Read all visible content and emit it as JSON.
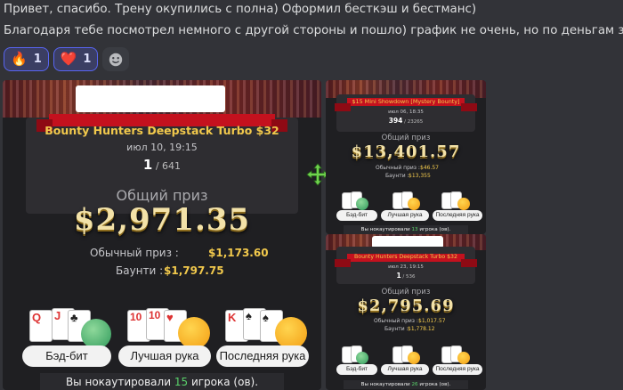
{
  "message": {
    "line1": "Привет, спасибо. Трену окупились с полна) Оформил бесткэш и бестманс)",
    "line2": "Благодаря тебе посмотрел немного с другой стороны и пошло) график не очень, но по деньгам збс)"
  },
  "reactions": [
    {
      "emoji": "🔥",
      "count": "1"
    },
    {
      "emoji": "❤️",
      "count": "1"
    }
  ],
  "card_main": {
    "title": "Bounty Hunters Deepstack Turbo $32",
    "date": "июл 10, 19:15",
    "place": "1",
    "total": "/ 641",
    "prize_label": "Общий приз",
    "prize_value": "$2,971.35",
    "regular_label": "Обычный приз :",
    "regular_value": "$1,173.60",
    "bounty_label": "Баунти :",
    "bounty_value": "$1,797.75",
    "badges": [
      "Бэд-бит",
      "Лучшая рука",
      "Последняя рука"
    ],
    "footer_pre": "Вы нокаутировали",
    "footer_num": "15",
    "footer_post": "игрока (ов)."
  },
  "card_top_right": {
    "title": "$15 Mini Showdown [Mystery Bounty]",
    "date": "июл 06, 18:35",
    "place": "394",
    "total": "/ 23265",
    "prize_label": "Общий приз",
    "prize_value": "$13,401.57",
    "regular_label": "Обычный приз :",
    "regular_value": "$46.57",
    "bounty_label": "Баунти :",
    "bounty_value": "$13,355",
    "badges": [
      "Бэд-бит",
      "Лучшая рука",
      "Последняя рука"
    ],
    "footer_pre": "Вы нокаутировали",
    "footer_num": "13",
    "footer_post": "игрока (ов)."
  },
  "card_bottom_right": {
    "title": "Bounty Hunters Deepstack Turbo $32",
    "date": "июл 23, 19:15",
    "place": "1",
    "total": "/ 536",
    "prize_label": "Общий приз",
    "prize_value": "$2,795.69",
    "regular_label": "Обычный приз :",
    "regular_value": "$1,017.57",
    "bounty_label": "Баунти :",
    "bounty_value": "$1,778.12",
    "badges": [
      "Бэд-бит",
      "Лучшая рука",
      "Последняя рука"
    ],
    "footer_pre": "Вы нокаутировали",
    "footer_num": "26",
    "footer_post": "игрока (ов)."
  },
  "colors": {
    "accent_gold": "#f2c94c",
    "reaction_border": "#5865f2",
    "knockout_green": "#5ad26b",
    "ribbon_red": "#c4111e"
  },
  "icons": [
    "fire-emoji",
    "heart-emoji",
    "add-reaction-icon",
    "move-cursor-icon",
    "playing-card-icon",
    "emoji-face-icon"
  ]
}
